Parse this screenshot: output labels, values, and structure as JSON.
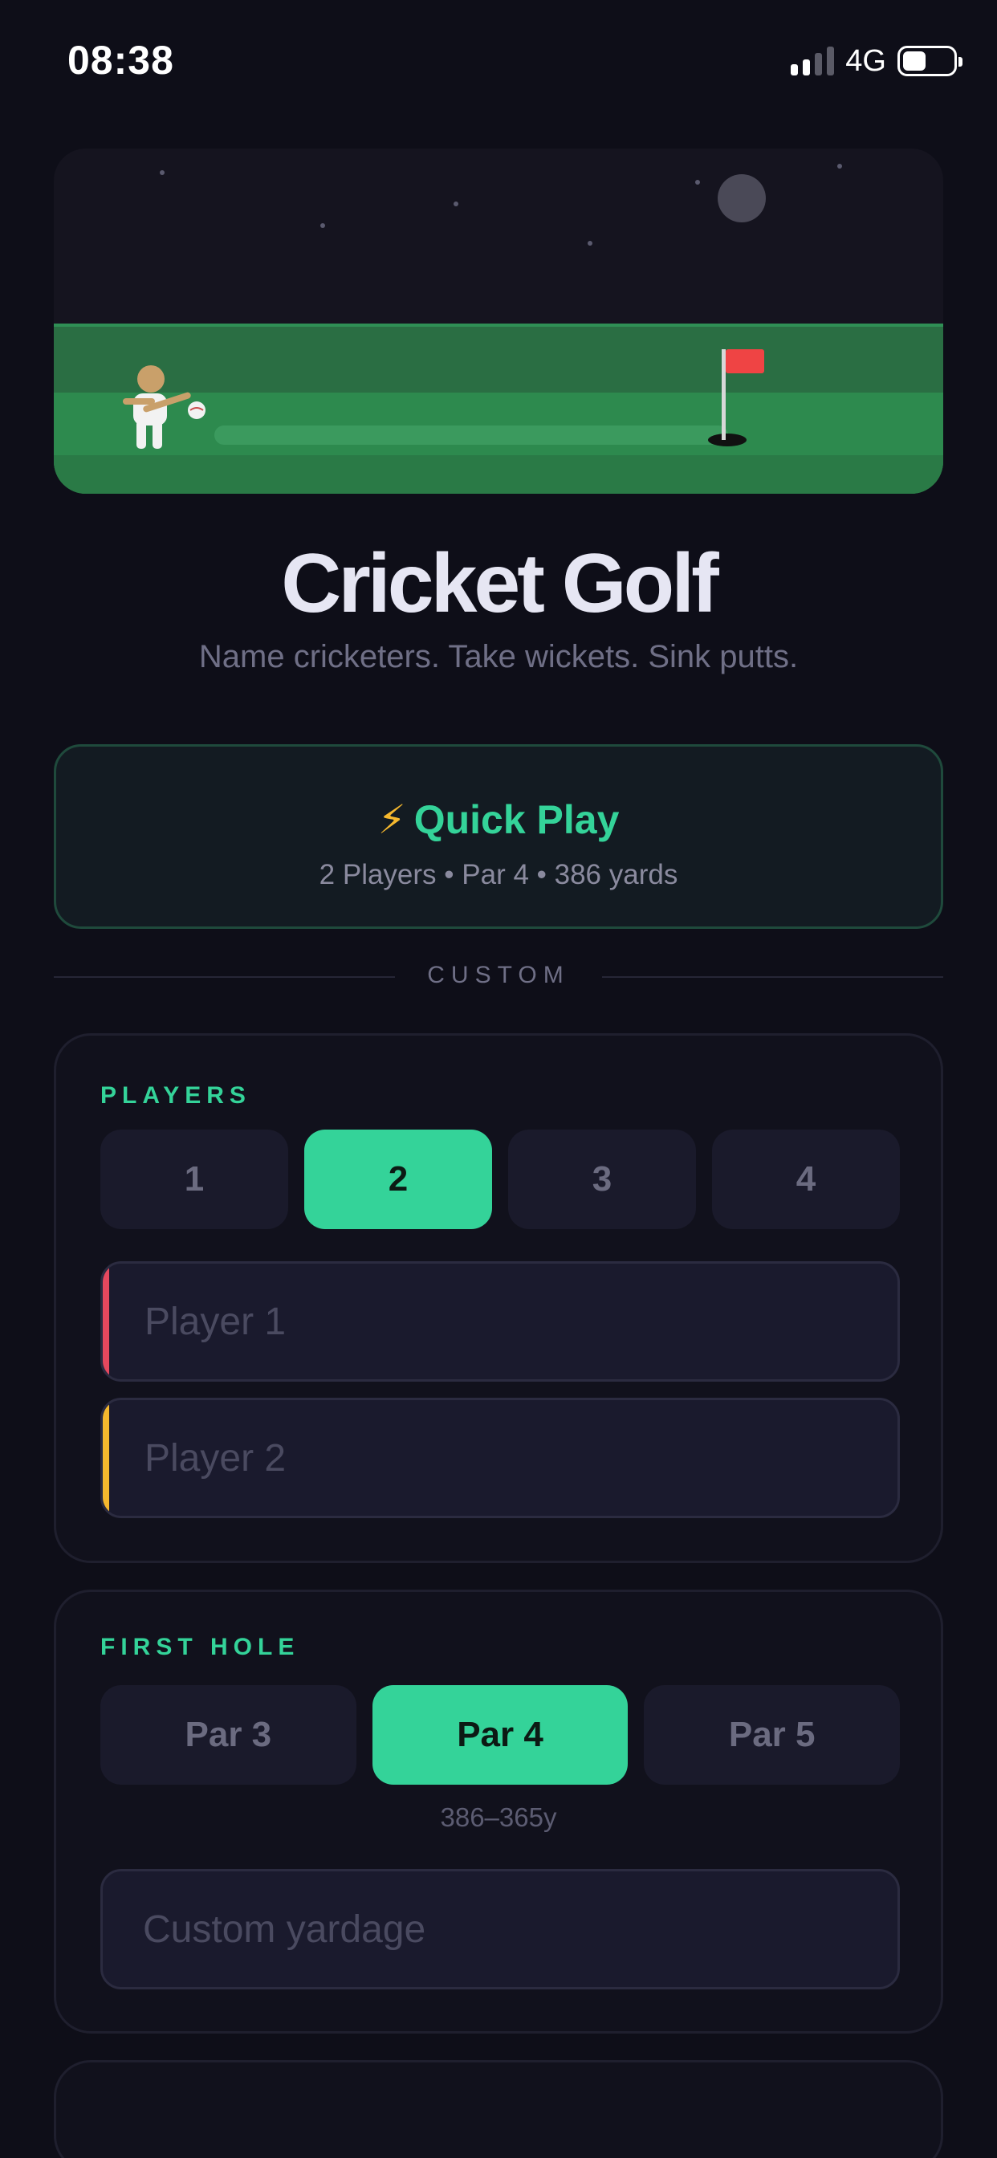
{
  "status_bar": {
    "time": "08:38",
    "network": "4G",
    "battery_level": 0.45
  },
  "app": {
    "title": "Cricket Golf",
    "subtitle": "Name cricketers. Take wickets. Sink putts."
  },
  "quick_play": {
    "icon": "lightning-icon",
    "label": "Quick Play",
    "details": "2 Players • Par 4 • 386 yards"
  },
  "divider": {
    "label": "CUSTOM"
  },
  "players": {
    "label": "PLAYERS",
    "options": [
      "1",
      "2",
      "3",
      "4"
    ],
    "selected": "2",
    "fields": [
      {
        "placeholder": "Player 1",
        "value": "",
        "accent_color": "#e5485e"
      },
      {
        "placeholder": "Player 2",
        "value": "",
        "accent_color": "#f5b82e"
      }
    ]
  },
  "first_hole": {
    "label": "FIRST HOLE",
    "options": [
      "Par 3",
      "Par 4",
      "Par 5"
    ],
    "selected": "Par 4",
    "yard_range": "386–365y",
    "custom_yardage": {
      "placeholder": "Custom yardage",
      "value": ""
    }
  },
  "colors": {
    "accent": "#34d399",
    "background": "#0e0e18",
    "card": "#11111c",
    "flag": "#ef4444"
  }
}
